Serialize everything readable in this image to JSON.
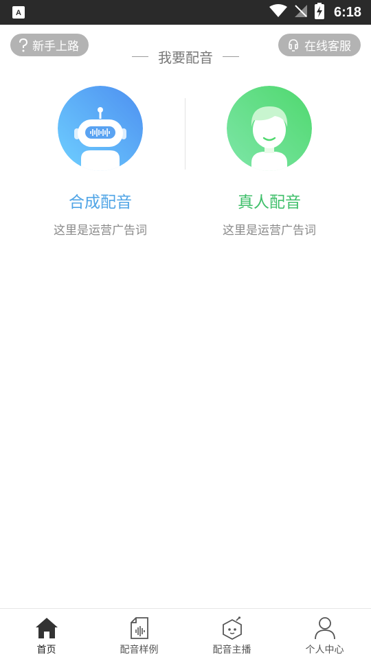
{
  "status_bar": {
    "time": "6:18"
  },
  "header": {
    "guide_label": "新手上路",
    "service_label": "在线客服",
    "title": "我要配音"
  },
  "cards": [
    {
      "title": "合成配音",
      "subtitle": "这里是运营广告词"
    },
    {
      "title": "真人配音",
      "subtitle": "这里是运营广告词"
    }
  ],
  "bottom_nav": [
    {
      "label": "首页",
      "icon": "home-icon"
    },
    {
      "label": "配音样例",
      "icon": "audio-file-icon"
    },
    {
      "label": "配音主播",
      "icon": "robot-icon"
    },
    {
      "label": "个人中心",
      "icon": "user-icon"
    }
  ],
  "colors": {
    "synth_accent": "#4fa4e6",
    "human_accent": "#3fbf6a",
    "pill_bg": "#b3b3b3"
  }
}
